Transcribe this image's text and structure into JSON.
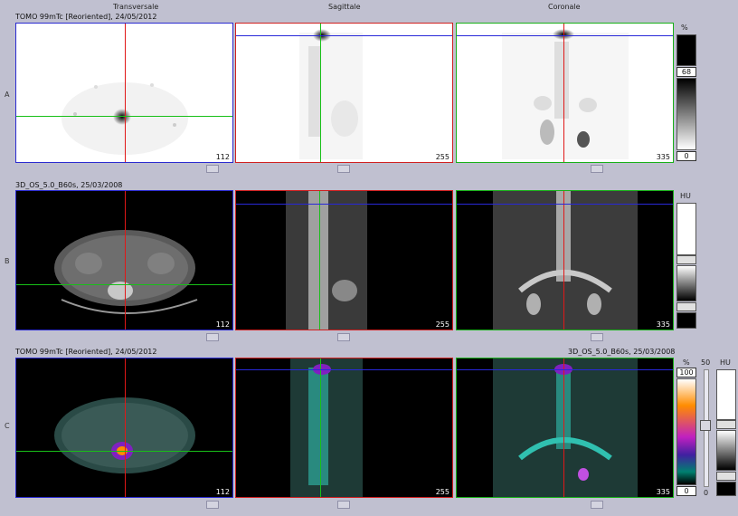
{
  "headers": {
    "transversal": "Transversale",
    "sagittal": "Sagittale",
    "coronal": "Coronale"
  },
  "rows": {
    "a": {
      "label": "A",
      "caption": "TOMO 99mTc [Reoriented], 24/05/2012"
    },
    "b": {
      "label": "B",
      "caption": "3D_OS_5.0_B60s, 25/03/2008"
    },
    "c": {
      "label": "C",
      "caption_left": "TOMO 99mTc [Reoriented], 24/05/2012",
      "caption_right": "3D_OS_5.0_B60s, 25/03/2008"
    }
  },
  "slices": {
    "transversal": "112",
    "sagittal": "255",
    "coronal": "335"
  },
  "scales": {
    "nm": {
      "unit": "%",
      "top": "68",
      "bottom": "0"
    },
    "ct": {
      "unit": "HU"
    },
    "fusion": {
      "pet_unit": "%",
      "pet_top": "100",
      "pet_bottom": "0",
      "blend_top": "50",
      "blend_bottom": "0",
      "ct_unit": "HU"
    }
  },
  "colors": {
    "red": "#e01818",
    "green": "#18c018",
    "blue": "#2828d8",
    "pet_orange": "#ff8c00",
    "pet_purple": "#8020c0",
    "ct_teal": "#30c0b0"
  }
}
